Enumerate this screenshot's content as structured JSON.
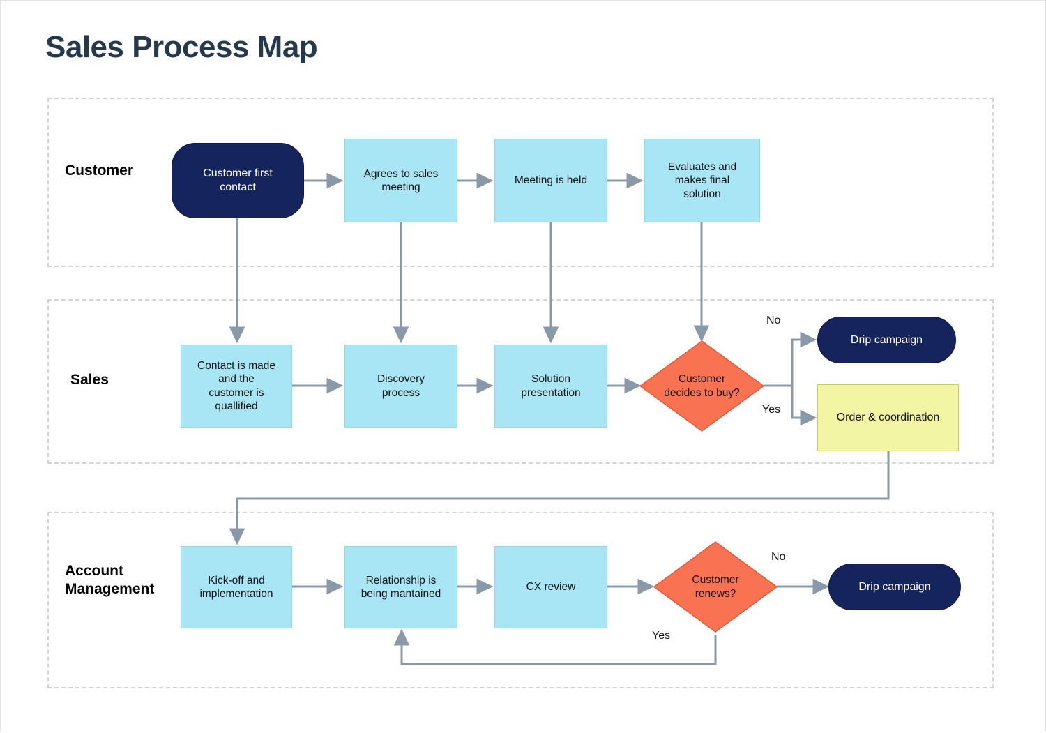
{
  "page": {
    "title": "Sales Process Map",
    "accent_navy": "#16245e",
    "accent_blue": "#a8e6f5",
    "accent_orange": "#f97252",
    "accent_yellow": "#f2f5a3",
    "title_color": "#25394e",
    "connector_color": "#8a99a8"
  },
  "lanes": [
    {
      "id": "customer",
      "label": "Customer"
    },
    {
      "id": "sales",
      "label": "Sales"
    },
    {
      "id": "account",
      "label": "Account\nManagement"
    }
  ],
  "nodes": {
    "customer_first_contact": {
      "label": "Customer first\ncontact",
      "shape": "terminator"
    },
    "agrees_to_sales_meeting": {
      "label": "Agrees to sales\nmeeting",
      "shape": "process"
    },
    "meeting_is_held": {
      "label": "Meeting is held",
      "shape": "process"
    },
    "evaluates_final_solution": {
      "label": "Evaluates and\nmakes final\nsolution",
      "shape": "process"
    },
    "contact_made_qualified": {
      "label": "Contact is made\nand the\ncustomer is\nquallified",
      "shape": "process"
    },
    "discovery_process": {
      "label": "Discovery\nprocess",
      "shape": "process"
    },
    "solution_presentation": {
      "label": "Solution\npresentation",
      "shape": "process"
    },
    "customer_decides_to_buy": {
      "label": "Customer\ndecides to buy?",
      "shape": "decision"
    },
    "drip_campaign_sales": {
      "label": "Drip campaign",
      "shape": "terminator"
    },
    "order_coordination": {
      "label": "Order & coordination",
      "shape": "document"
    },
    "kickoff_implementation": {
      "label": "Kick-off and\nimplementation",
      "shape": "process"
    },
    "relationship_maintained": {
      "label": "Relationship is\nbeing mantained",
      "shape": "process"
    },
    "cx_review": {
      "label": "CX review",
      "shape": "process"
    },
    "customer_renews": {
      "label": "Customer\nrenews?",
      "shape": "decision"
    },
    "drip_campaign_account": {
      "label": "Drip campaign",
      "shape": "terminator"
    }
  },
  "edge_labels": {
    "buy_no": "No",
    "buy_yes": "Yes",
    "renew_no": "No",
    "renew_yes": "Yes"
  }
}
